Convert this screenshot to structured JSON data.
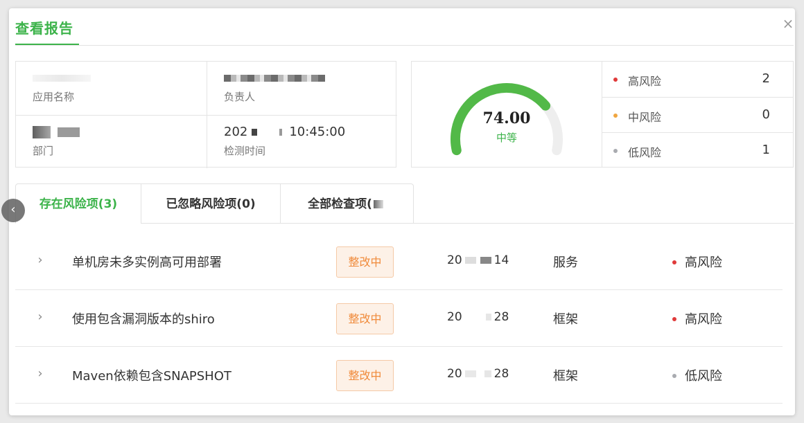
{
  "dialog": {
    "title": "查看报告",
    "close_glyph": "×"
  },
  "info": {
    "app_name": {
      "value": "",
      "label": "应用名称"
    },
    "owner": {
      "value": "",
      "label": "负责人"
    },
    "department": {
      "value": "",
      "label": "部门"
    },
    "check_time": {
      "value_prefix": "202",
      "value_suffix": "10:45:00",
      "label": "检测时间"
    }
  },
  "score": {
    "value": "74.00",
    "fraction": 0.74,
    "level": "中等",
    "gauge_color": "#52b948",
    "track_color": "#eeeeee"
  },
  "risk_summary": [
    {
      "name": "高风险",
      "count": "2",
      "color": "#e03a3a"
    },
    {
      "name": "中风险",
      "count": "0",
      "color": "#f0a640"
    },
    {
      "name": "低风险",
      "count": "1",
      "color": "#a9abb0"
    }
  ],
  "tabs": [
    {
      "label": "存在风险项(3)",
      "active": true
    },
    {
      "label": "已忽略风险项(0)",
      "active": false
    },
    {
      "label": "全部检查项(",
      "active": false
    }
  ],
  "items": [
    {
      "title": "单机房未多实例高可用部署",
      "status": "整改中",
      "date_prefix": "20",
      "date_suffix": "14",
      "type": "服务",
      "level": "高风险",
      "level_color": "#e03a3a"
    },
    {
      "title": "使用包含漏洞版本的shiro",
      "status": "整改中",
      "date_prefix": "20",
      "date_suffix": "28",
      "type": "框架",
      "level": "高风险",
      "level_color": "#e03a3a"
    },
    {
      "title": "Maven依赖包含SNAPSHOT",
      "status": "整改中",
      "date_prefix": "20",
      "date_suffix": "28",
      "type": "框架",
      "level": "低风险",
      "level_color": "#a9abb0"
    }
  ],
  "icons": {
    "close": "close-icon",
    "expand": "chevron-right-icon",
    "prev": "chevron-left-icon"
  },
  "colors": {
    "accent": "#3cb34a",
    "status_bg": "#fdf1e7",
    "status_text": "#f08a3a"
  }
}
